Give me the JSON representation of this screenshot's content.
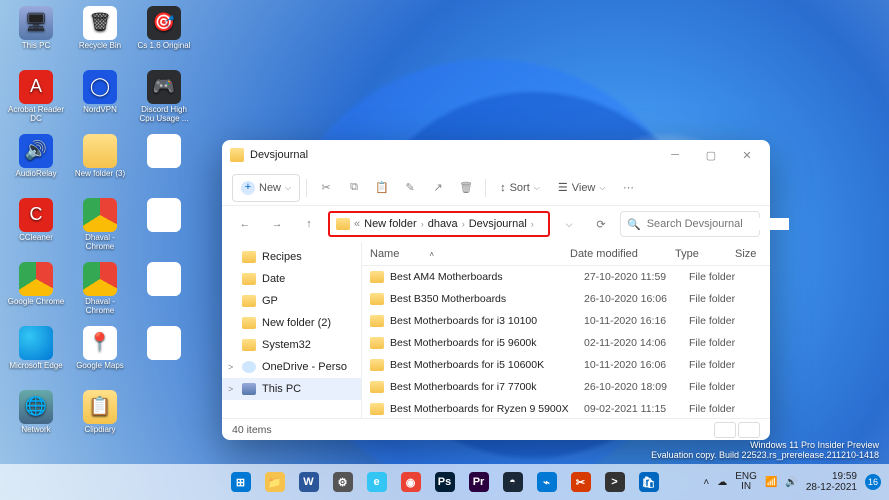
{
  "desktop_icons": [
    {
      "id": "this-pc",
      "label": "This PC",
      "cls": "pc",
      "glyph": "🖥"
    },
    {
      "id": "recycle-bin",
      "label": "Recycle Bin",
      "cls": "bin",
      "glyph": "🗑"
    },
    {
      "id": "cs16",
      "label": "Cs 1.6 Original",
      "cls": "dk",
      "glyph": "🎯"
    },
    {
      "id": "acrobat",
      "label": "Acrobat Reader DC",
      "cls": "red",
      "glyph": "A"
    },
    {
      "id": "nordvpn",
      "label": "NordVPN",
      "cls": "blue",
      "glyph": "◯"
    },
    {
      "id": "discord",
      "label": "Discord High Cpu Usage ...",
      "cls": "dk",
      "glyph": "🎮"
    },
    {
      "id": "audiorelay",
      "label": "AudioRelay",
      "cls": "blue",
      "glyph": "🔊"
    },
    {
      "id": "newfolder3",
      "label": "New folder (3)",
      "cls": "fld",
      "glyph": ""
    },
    {
      "id": "blank1",
      "label": "",
      "cls": "",
      "glyph": ""
    },
    {
      "id": "ccleaner",
      "label": "CCleaner",
      "cls": "red",
      "glyph": "C"
    },
    {
      "id": "dhaval-chrome",
      "label": "Dhaval - Chrome",
      "cls": "chrome",
      "glyph": ""
    },
    {
      "id": "blank2",
      "label": "",
      "cls": "",
      "glyph": ""
    },
    {
      "id": "google-chrome",
      "label": "Google Chrome",
      "cls": "chrome",
      "glyph": ""
    },
    {
      "id": "dhaval-chrome2",
      "label": "Dhaval - Chrome",
      "cls": "chrome",
      "glyph": ""
    },
    {
      "id": "blank3",
      "label": "",
      "cls": "",
      "glyph": ""
    },
    {
      "id": "edge",
      "label": "Microsoft Edge",
      "cls": "edge",
      "glyph": ""
    },
    {
      "id": "gmaps",
      "label": "Google Maps",
      "cls": "maps",
      "glyph": "📍"
    },
    {
      "id": "blank4",
      "label": "",
      "cls": "",
      "glyph": ""
    },
    {
      "id": "network",
      "label": "Network",
      "cls": "net",
      "glyph": "🌐"
    },
    {
      "id": "clipdiary",
      "label": "Clipdiary",
      "cls": "fld",
      "glyph": "📋"
    }
  ],
  "explorer": {
    "title": "Devsjournal",
    "new_label": "New",
    "sort_label": "Sort",
    "view_label": "View",
    "breadcrumb": [
      "New folder",
      "dhava",
      "Devsjournal"
    ],
    "search_placeholder": "Search Devsjournal",
    "sidebar": [
      {
        "label": "Recipes",
        "kind": "folder"
      },
      {
        "label": "Date",
        "kind": "folder"
      },
      {
        "label": "GP",
        "kind": "folder"
      },
      {
        "label": "New folder (2)",
        "kind": "folder"
      },
      {
        "label": "System32",
        "kind": "folder"
      },
      {
        "label": "OneDrive - Perso",
        "kind": "cloud",
        "caret": ">"
      },
      {
        "label": "This PC",
        "kind": "pc",
        "caret": ">",
        "sel": true
      }
    ],
    "columns": {
      "name": "Name",
      "date": "Date modified",
      "type": "Type",
      "size": "Size"
    },
    "rows": [
      {
        "name": "Best AM4 Motherboards",
        "date": "27-10-2020 11:59",
        "type": "File folder"
      },
      {
        "name": "Best B350 Motherboards",
        "date": "26-10-2020 16:06",
        "type": "File folder"
      },
      {
        "name": "Best Motherboards for i3 10100",
        "date": "10-11-2020 16:16",
        "type": "File folder"
      },
      {
        "name": "Best Motherboards for i5 9600k",
        "date": "02-11-2020 14:06",
        "type": "File folder"
      },
      {
        "name": "Best Motherboards for i5 10600K",
        "date": "10-11-2020 16:06",
        "type": "File folder"
      },
      {
        "name": "Best Motherboards for i7 7700k",
        "date": "26-10-2020 18:09",
        "type": "File folder"
      },
      {
        "name": "Best Motherboards for Ryzen 9 5900X",
        "date": "09-02-2021 11:15",
        "type": "File folder"
      }
    ],
    "status": "40 items"
  },
  "watermark": {
    "l1": "Windows 11 Pro Insider Preview",
    "l2": "Evaluation copy. Build 22523.rs_prerelease.211210-1418"
  },
  "tray": {
    "lang": "ENG\nIN",
    "time": "19:59",
    "date": "28-12-2021",
    "notif": "16"
  },
  "taskbar_apps": [
    {
      "id": "start",
      "color": "#0078d4",
      "glyph": "⊞"
    },
    {
      "id": "explorer",
      "color": "#f5c34d",
      "glyph": "📁"
    },
    {
      "id": "word",
      "color": "#2b579a",
      "glyph": "W"
    },
    {
      "id": "settings",
      "color": "#555",
      "glyph": "⚙"
    },
    {
      "id": "edge",
      "color": "#33c6f4",
      "glyph": "e"
    },
    {
      "id": "chrome",
      "color": "#ea4335",
      "glyph": "◉"
    },
    {
      "id": "photoshop",
      "color": "#001e36",
      "glyph": "Ps"
    },
    {
      "id": "premiere",
      "color": "#2a003f",
      "glyph": "Pr"
    },
    {
      "id": "steam",
      "color": "#1b2838",
      "glyph": "◓"
    },
    {
      "id": "vscode",
      "color": "#0078d4",
      "glyph": "⌁"
    },
    {
      "id": "snip",
      "color": "#d83b01",
      "glyph": "✂"
    },
    {
      "id": "terminal",
      "color": "#333",
      "glyph": ">"
    },
    {
      "id": "store",
      "color": "#0067c0",
      "glyph": "🛍"
    }
  ]
}
